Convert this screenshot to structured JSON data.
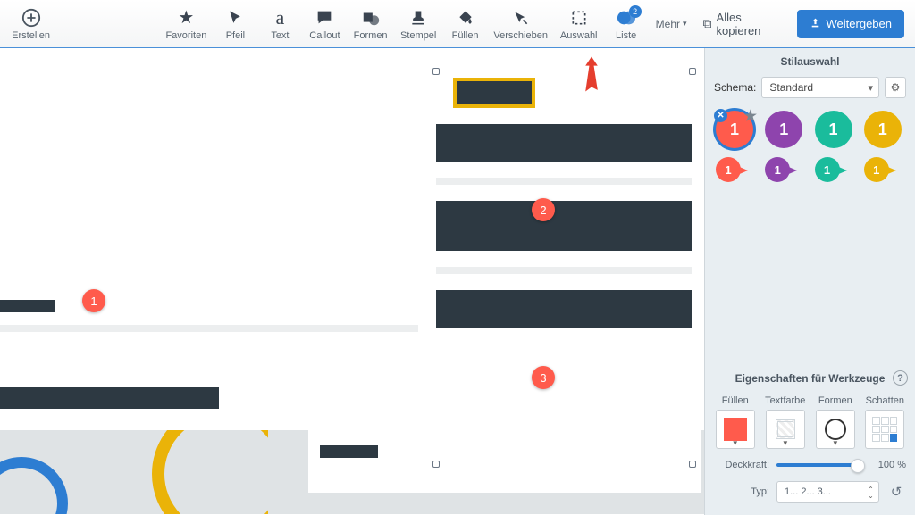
{
  "toolbar": {
    "create": "Erstellen",
    "favorites": "Favoriten",
    "arrow": "Pfeil",
    "text": "Text",
    "callout": "Callout",
    "shapes": "Formen",
    "stamp": "Stempel",
    "fill": "Füllen",
    "move": "Verschieben",
    "select": "Auswahl",
    "list": "Liste",
    "list_badge": "2",
    "more": "Mehr",
    "copy_all": "Alles kopieren",
    "share": "Weitergeben"
  },
  "canvas": {
    "badge1": "1",
    "badge2": "2",
    "badge3": "3"
  },
  "panel": {
    "title_styles": "Stilauswahl",
    "schema_label": "Schema:",
    "schema_value": "Standard",
    "style_colors": [
      {
        "hex": "#ff5b4c",
        "label": "1",
        "selected": true
      },
      {
        "hex": "#8e44ad",
        "label": "1"
      },
      {
        "hex": "#1abc9c",
        "label": "1"
      },
      {
        "hex": "#eab308",
        "label": "1"
      }
    ],
    "bubble_colors": [
      {
        "hex": "#ff5b4c",
        "label": "1"
      },
      {
        "hex": "#8e44ad",
        "label": "1"
      },
      {
        "hex": "#1abc9c",
        "label": "1"
      },
      {
        "hex": "#eab308",
        "label": "1"
      }
    ],
    "title_props": "Eigenschaften für Werkzeuge",
    "prop_fill": "Füllen",
    "prop_textcolor": "Textfarbe",
    "prop_shapes": "Formen",
    "prop_shadow": "Schatten",
    "opacity_label": "Deckkraft:",
    "opacity_value": "100 %",
    "type_label": "Typ:",
    "type_value": "1... 2... 3..."
  }
}
